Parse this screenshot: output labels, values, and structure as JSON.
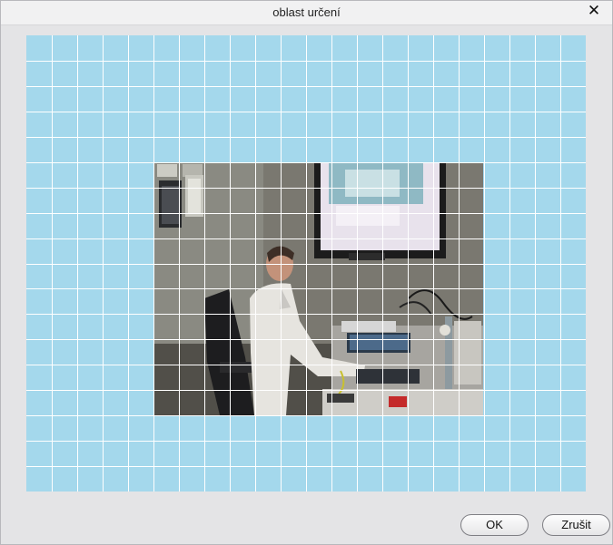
{
  "dialog": {
    "title": "oblast určení",
    "close_glyph": "✕"
  },
  "region_grid": {
    "columns": 22,
    "rows": 18,
    "selected_fill": "#a4d8ec",
    "line_color": "#ffffff"
  },
  "buttons": {
    "ok_label": "OK",
    "cancel_label": "Zrušit"
  }
}
